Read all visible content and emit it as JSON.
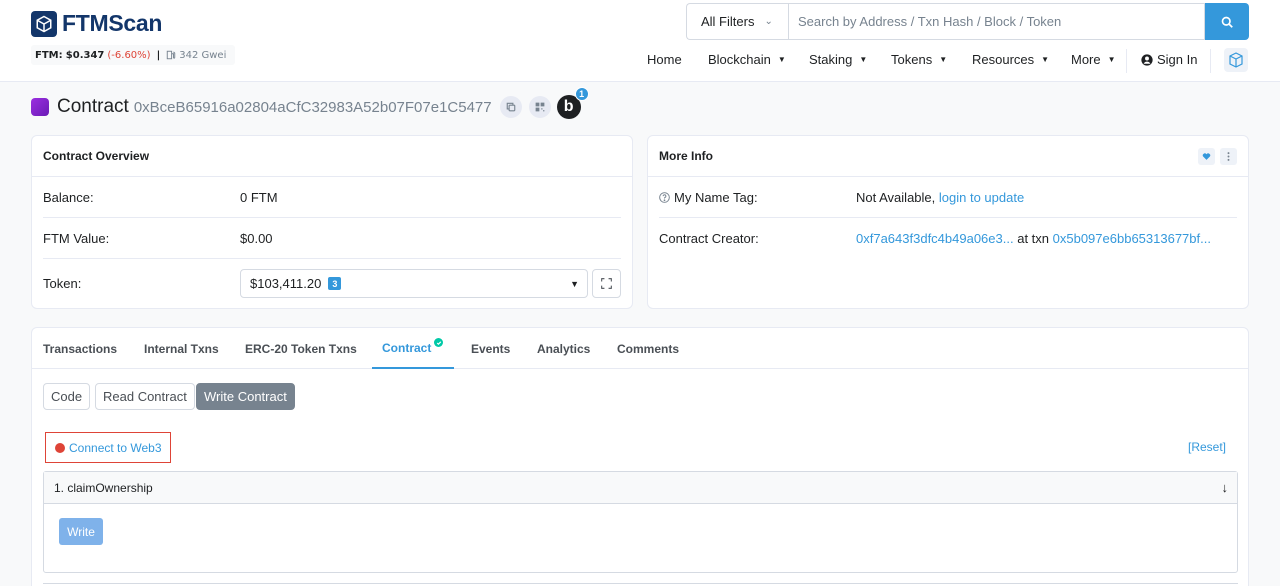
{
  "header": {
    "logo_text": "FTMScan",
    "price_label": "FTM:",
    "price_value": "$0.347",
    "price_change": "(-6.60%)",
    "separator": "|",
    "gas": "342 Gwei",
    "filter_label": "All Filters",
    "search_placeholder": "Search by Address / Txn Hash / Block / Token"
  },
  "nav": {
    "home": "Home",
    "blockchain": "Blockchain",
    "staking": "Staking",
    "tokens": "Tokens",
    "resources": "Resources",
    "more": "More",
    "sign_in": "Sign In"
  },
  "page": {
    "title": "Contract",
    "address": "0xBceB65916a02804aCfC32983A52b07F07e1C5477",
    "blockscan_letter": "b",
    "blockscan_badge": "1"
  },
  "overview": {
    "heading": "Contract Overview",
    "balance_label": "Balance:",
    "balance_value": "0 FTM",
    "value_label": "FTM Value:",
    "value_value": "$0.00",
    "token_label": "Token:",
    "token_value": "$103,411.20",
    "token_count": "3"
  },
  "more_info": {
    "heading": "More Info",
    "name_tag_label": "My Name Tag:",
    "name_tag_value": "Not Available,",
    "name_tag_link": "login to update",
    "creator_label": "Contract Creator:",
    "creator_address": "0xf7a643f3dfc4b49a06e3...",
    "creator_at": "at txn",
    "creator_txn": "0x5b097e6bb65313677bf..."
  },
  "tabs": {
    "transactions": "Transactions",
    "internal": "Internal Txns",
    "erc20": "ERC-20 Token Txns",
    "contract": "Contract",
    "events": "Events",
    "analytics": "Analytics",
    "comments": "Comments"
  },
  "contract_tab": {
    "code": "Code",
    "read": "Read Contract",
    "write": "Write Contract",
    "connect": "Connect to Web3",
    "reset": "[Reset]",
    "function_1": "1. claimOwnership",
    "write_button": "Write"
  },
  "colors": {
    "brand": "#13366a",
    "accent": "#3498db",
    "negative": "#de4437",
    "verified": "#00c9a7"
  }
}
